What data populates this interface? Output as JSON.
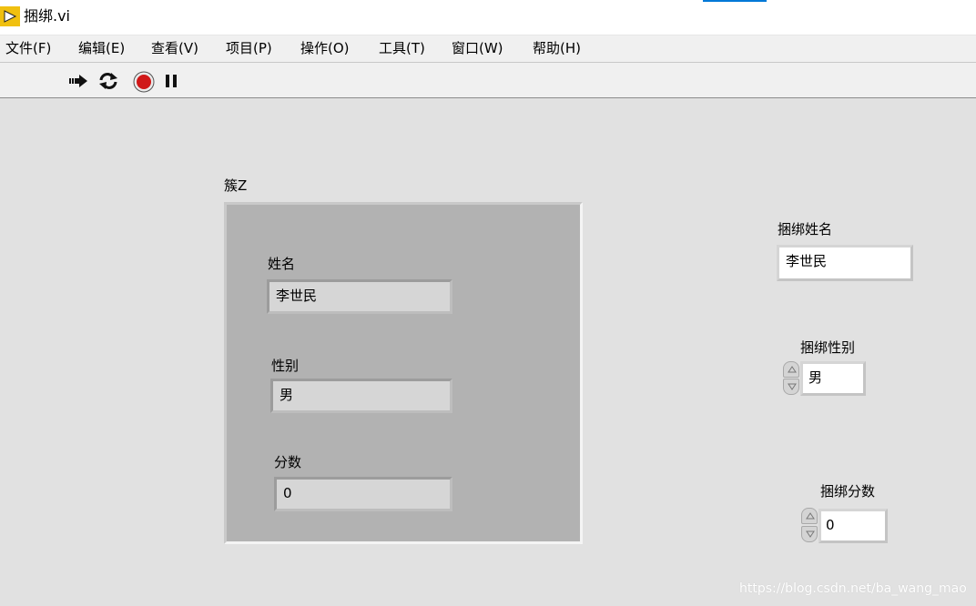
{
  "window": {
    "title": "捆绑.vi"
  },
  "menu": [
    {
      "label": "文件(F)"
    },
    {
      "label": "编辑(E)"
    },
    {
      "label": "查看(V)"
    },
    {
      "label": "项目(P)"
    },
    {
      "label": "操作(O)"
    },
    {
      "label": "工具(T)"
    },
    {
      "label": "窗口(W)"
    },
    {
      "label": "帮助(H)"
    }
  ],
  "toolbar": {
    "buttons": [
      {
        "icon": "run-arrow-icon"
      },
      {
        "icon": "run-continuously-icon"
      },
      {
        "icon": "abort-stop-icon"
      },
      {
        "icon": "pause-icon"
      }
    ]
  },
  "cluster": {
    "label": "簇Z",
    "name": {
      "label": "姓名",
      "value": "李世民"
    },
    "gender": {
      "label": "性别",
      "value": "男"
    },
    "score": {
      "label": "分数",
      "value": "0"
    }
  },
  "bundle_name": {
    "label": "捆绑姓名",
    "value": "李世民"
  },
  "bundle_gender": {
    "label": "捆绑性别",
    "value": "男"
  },
  "bundle_score": {
    "label": "捆绑分数",
    "value": "0"
  },
  "watermark": "https://blog.csdn.net/ba_wang_mao",
  "colors": {
    "panel_bg": "#e1e1e1",
    "cluster_bg": "#b2b2b2",
    "stop_red": "#d01818",
    "accent": "#0078d7",
    "labview_yellow": "#f0c010"
  }
}
